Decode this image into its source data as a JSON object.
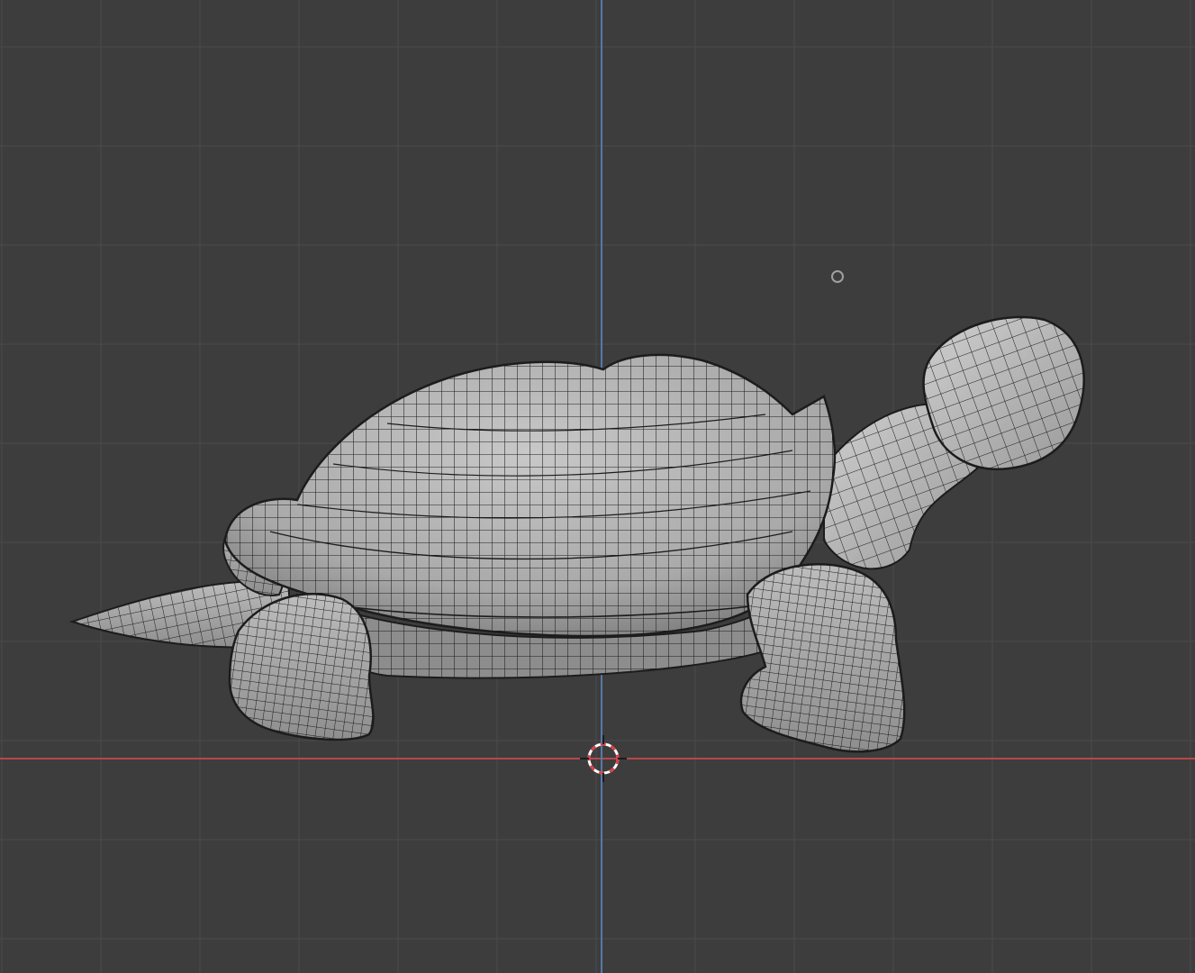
{
  "viewport": {
    "background_color": "#3d3d3d",
    "grid_color": "#4a4a4a",
    "x_axis_color": "#b8474c",
    "y_axis_color": "#5579a8",
    "mesh_fill_color": "#b4b4b4",
    "mesh_wire_color": "#1c1c1c"
  },
  "scene": {
    "object": "turtle-mesh",
    "shading": "wireframe-overlay",
    "cursor_icon": "3d-cursor-icon",
    "origin_icon": "object-origin-icon",
    "light_icon": "light-icon"
  }
}
